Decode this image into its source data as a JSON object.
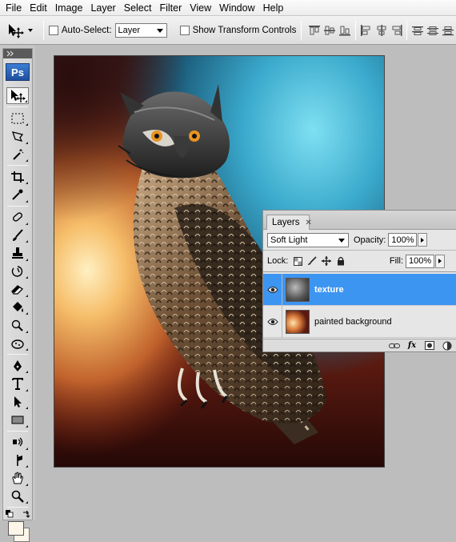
{
  "menu": [
    "File",
    "Edit",
    "Image",
    "Layer",
    "Select",
    "Filter",
    "View",
    "Window",
    "Help"
  ],
  "options_bar": {
    "tool_icon": "move-tool-icon",
    "auto_select_label": "Auto-Select:",
    "auto_select_value": "Layer",
    "show_transform_label": "Show Transform Controls"
  },
  "toolbox": {
    "logo": "Ps",
    "tools": [
      "move-tool-icon",
      "marquee-tool-icon",
      "lasso-tool-icon",
      "magic-wand-tool-icon",
      "crop-tool-icon",
      "eyedropper-tool-icon",
      "healing-brush-tool-icon",
      "brush-tool-icon",
      "clone-stamp-tool-icon",
      "history-brush-tool-icon",
      "eraser-tool-icon",
      "paint-bucket-tool-icon",
      "dodge-tool-icon",
      "sponge-tool-icon",
      "pen-tool-icon",
      "type-tool-icon",
      "path-selection-tool-icon",
      "shape-tool-icon",
      "3d-rotate-tool-icon",
      "3d-camera-tool-icon",
      "hand-tool-icon",
      "zoom-tool-icon"
    ],
    "foreground_color": "#000000",
    "background_color": "#fdf6e8"
  },
  "layers_panel": {
    "tab_label": "Layers",
    "blend_mode": "Soft Light",
    "opacity_label": "Opacity:",
    "opacity_value": "100%",
    "lock_label": "Lock:",
    "fill_label": "Fill:",
    "fill_value": "100%",
    "layers": [
      {
        "name": "texture",
        "selected": true,
        "visible": true
      },
      {
        "name": "painted background",
        "selected": false,
        "visible": true
      }
    ],
    "footer_icons": [
      "link-layers-icon",
      "fx-icon",
      "layer-mask-icon",
      "adjustment-layer-icon"
    ]
  },
  "colors": {
    "selection_blue": "#3d95f2",
    "workspace_gray": "#bdbdbd"
  }
}
